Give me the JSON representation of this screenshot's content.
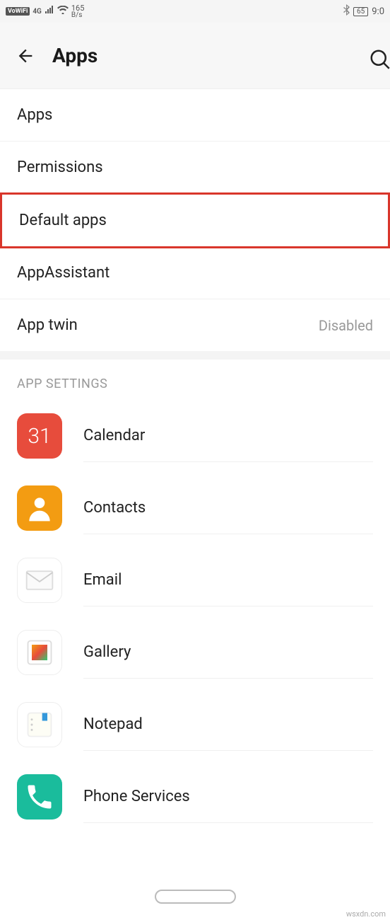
{
  "statusBar": {
    "vowifi": "VoWiFi",
    "network": "4G",
    "speedNum": "165",
    "speedUnit": "B/s",
    "battery": "65",
    "time": "9:0"
  },
  "header": {
    "title": "Apps"
  },
  "menu": {
    "apps": "Apps",
    "permissions": "Permissions",
    "defaultApps": "Default apps",
    "appAssistant": "AppAssistant",
    "appTwin": "App twin",
    "appTwinValue": "Disabled"
  },
  "sectionHeader": "APP SETTINGS",
  "apps": [
    {
      "label": "Calendar",
      "iconText": "31",
      "iconClass": "icon-calendar"
    },
    {
      "label": "Contacts",
      "iconText": "",
      "iconClass": "icon-contacts"
    },
    {
      "label": "Email",
      "iconText": "",
      "iconClass": "icon-email"
    },
    {
      "label": "Gallery",
      "iconText": "",
      "iconClass": "icon-gallery"
    },
    {
      "label": "Notepad",
      "iconText": "",
      "iconClass": "icon-notepad"
    },
    {
      "label": "Phone Services",
      "iconText": "",
      "iconClass": "icon-phone"
    }
  ],
  "watermark": "wsxdn.com"
}
